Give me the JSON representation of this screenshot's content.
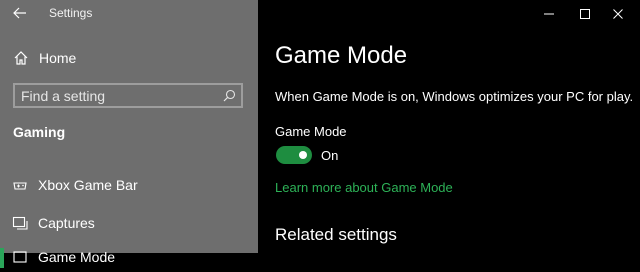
{
  "window": {
    "title": "Settings",
    "controls": [
      "minimize",
      "maximize",
      "close"
    ]
  },
  "sidebar": {
    "home_label": "Home",
    "search": {
      "placeholder": "Find a setting",
      "value": ""
    },
    "section_heading": "Gaming",
    "items": [
      {
        "label": "Xbox Game Bar",
        "icon": "gamebar-icon"
      },
      {
        "label": "Captures",
        "icon": "captures-icon"
      },
      {
        "label": "Game Mode",
        "icon": "gamemode-icon",
        "selected": true
      }
    ]
  },
  "main": {
    "page_title": "Game Mode",
    "description": "When Game Mode is on, Windows optimizes your PC for play.",
    "toggle": {
      "label": "Game Mode",
      "state_text": "On",
      "on": true
    },
    "learn_more": "Learn more about Game Mode",
    "related_heading": "Related settings"
  },
  "colors": {
    "sidebar_bg": "#6e6e6e",
    "main_bg": "#000000",
    "accent": "#1e8d40",
    "link": "#2db257"
  }
}
